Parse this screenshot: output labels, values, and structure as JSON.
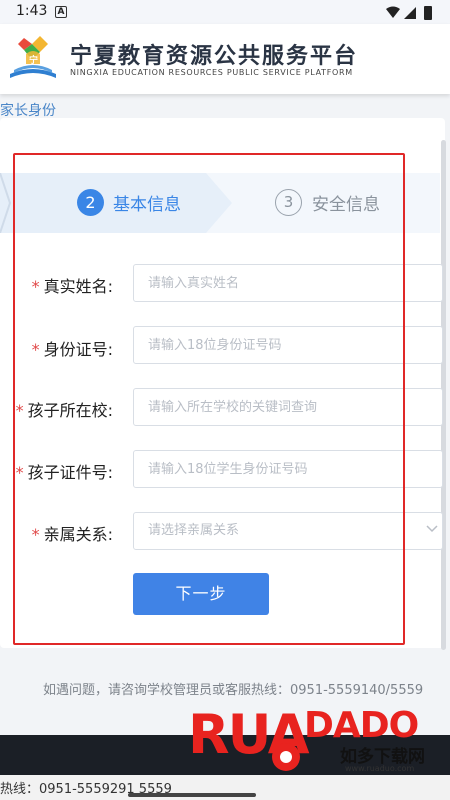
{
  "status_bar": {
    "time": "1:43",
    "notification_icon": "A"
  },
  "header": {
    "title": "宁夏教育资源公共服务平台",
    "subtitle": "NINGXIA EDUCATION RESOURCES PUBLIC SERVICE PLATFORM"
  },
  "role_tab": "家长身份",
  "steps": [
    {
      "number": "2",
      "label": "基本信息",
      "active": true
    },
    {
      "number": "3",
      "label": "安全信息",
      "active": false
    }
  ],
  "form": {
    "fields": [
      {
        "label": "真实姓名:",
        "placeholder": "请输入真实姓名",
        "required": true
      },
      {
        "label": "身份证号:",
        "placeholder": "请输入18位身份证号码",
        "required": true
      },
      {
        "label": "孩子所在校:",
        "placeholder": "请输入所在学校的关键词查询",
        "required": true
      },
      {
        "label": "孩子证件号:",
        "placeholder": "请输入18位学生身份证号码",
        "required": true
      },
      {
        "label": "亲属关系:",
        "placeholder": "请选择亲属关系",
        "required": true,
        "type": "select"
      }
    ],
    "required_mark": "*",
    "next_label": "下一步"
  },
  "footer_note": "如遇问题，请咨询学校管理员或客服热线：0951-5559140/5559",
  "hotline": "热线：0951-5559291  5559",
  "watermark": {
    "brand": "RUANDADO",
    "site_name": "如多下载网",
    "url": "www.ruaduo.com"
  },
  "colors": {
    "accent": "#3a86e6",
    "required": "#e04848",
    "highlight": "#e02828",
    "inactive": "#8a939d"
  }
}
